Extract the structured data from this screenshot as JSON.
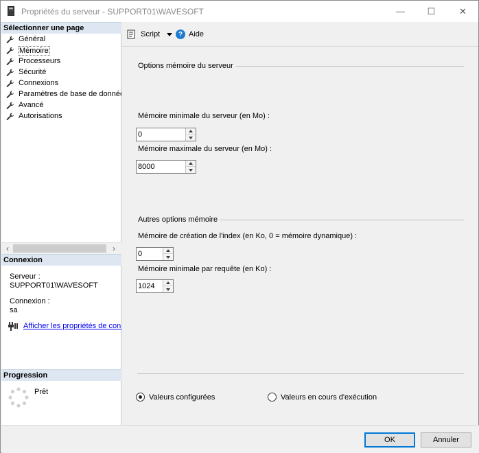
{
  "window": {
    "title": "Propriétés du serveur - SUPPORT01\\WAVESOFT",
    "minimize_glyph": "—",
    "maximize_glyph": "☐",
    "close_glyph": "✕"
  },
  "sidebar": {
    "header": "Sélectionner une page",
    "items": [
      {
        "label": "Général",
        "icon": "wrench-icon"
      },
      {
        "label": "Mémoire",
        "icon": "wrench-icon",
        "selected": true
      },
      {
        "label": "Processeurs",
        "icon": "wrench-icon"
      },
      {
        "label": "Sécurité",
        "icon": "wrench-icon"
      },
      {
        "label": "Connexions",
        "icon": "wrench-icon"
      },
      {
        "label": "Paramètres de base de données",
        "icon": "wrench-icon"
      },
      {
        "label": "Avancé",
        "icon": "wrench-icon"
      },
      {
        "label": "Autorisations",
        "icon": "wrench-icon"
      }
    ],
    "scroll_left_glyph": "‹",
    "scroll_right_glyph": "›"
  },
  "connection": {
    "header": "Connexion",
    "server_label": "Serveur :",
    "server_value": "SUPPORT01\\WAVESOFT",
    "login_label": "Connexion :",
    "login_value": "sa",
    "link_label": "Afficher les propriétés de connexion"
  },
  "progress": {
    "header": "Progression",
    "status": "Prêt"
  },
  "toolbar": {
    "script_label": "Script",
    "help_label": "Aide",
    "help_glyph": "?"
  },
  "memory": {
    "group_title": "Options mémoire du serveur",
    "min_label": "Mémoire minimale du serveur (en Mo) :",
    "min_value": "0",
    "max_label": "Mémoire maximale du serveur (en Mo) :",
    "max_value": "8000"
  },
  "other_memory": {
    "group_title": "Autres options mémoire",
    "index_label": "Mémoire de création de l'index (en Ko, 0 = mémoire dynamique) :",
    "index_value": "0",
    "query_label": "Mémoire minimale par requête (en Ko) :",
    "query_value": "1024"
  },
  "radios": {
    "configured_label": "Valeurs configurées",
    "configured_selected": true,
    "running_label": "Valeurs en cours d'exécution",
    "running_selected": false
  },
  "buttons": {
    "ok_label": "OK",
    "cancel_label": "Annuler"
  },
  "colors": {
    "section_header_bg": "#dde6f1",
    "link": "#0000ee",
    "default_button_border": "#0078d7",
    "help_icon": "#1e7bd2"
  }
}
